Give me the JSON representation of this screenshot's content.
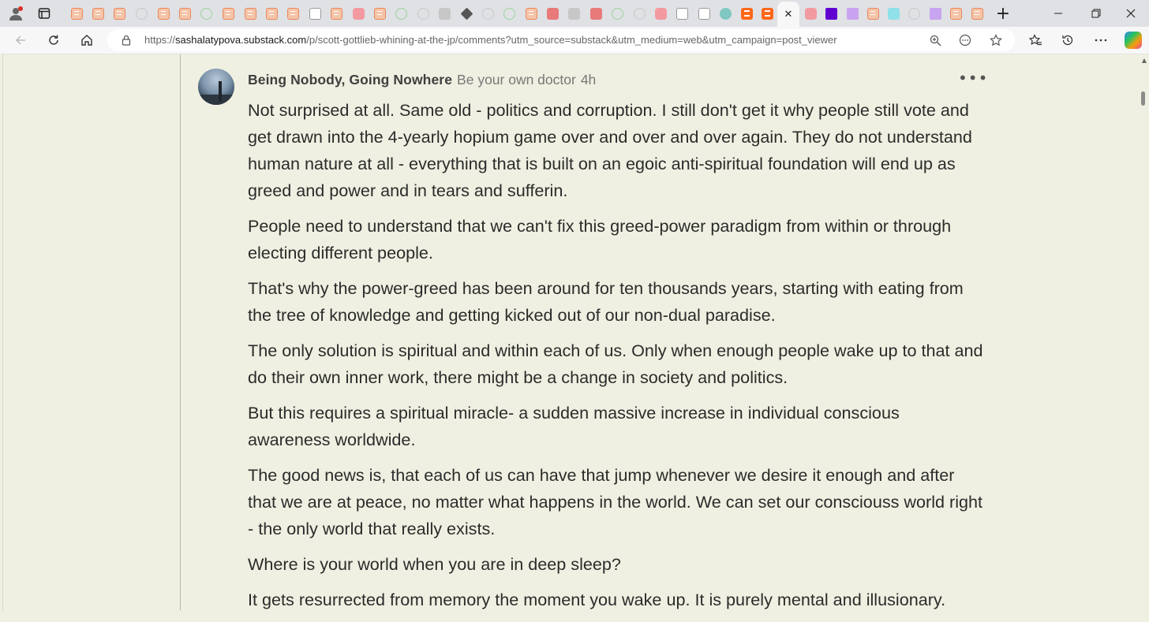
{
  "browser": {
    "url_scheme": "https://",
    "url_host": "sashalatypova.substack.com",
    "url_path": "/p/scott-gottlieb-whining-at-the-jp/comments?utm_source=substack&utm_medium=web&utm_campaign=post_viewer",
    "active_tab_close_symbol": "✕",
    "new_tab_symbol": "+",
    "icons": [
      "profile-icon",
      "tab-actions-icon",
      "back-icon",
      "refresh-icon",
      "home-icon",
      "site-info-icon",
      "zoom-icon",
      "reader-icon",
      "favorite-star-icon",
      "favorites-icon",
      "history-icon",
      "more-icon",
      "copilot-icon",
      "minimize-icon",
      "restore-icon",
      "close-icon"
    ]
  },
  "comment": {
    "author": "Being Nobody, Going Nowhere",
    "author_description": "Be your own doctor",
    "time_ago": "4h",
    "more_symbol": "•••",
    "paragraphs": [
      "Not surprised at all. Same old - politics and corruption. I still don't get it why people still vote and get drawn into the 4-yearly hopium game over and over and over again. They do not understand human nature at all - everything that is built on an egoic anti-spiritual foundation will end up as greed and power and in tears and sufferin.",
      "People need to understand that we can't fix this greed-power paradigm from within or through electing different people.",
      "That's why the power-greed has been around for ten thousands years, starting with eating from the tree of knowledge and getting kicked out of our non-dual paradise.",
      "The only solution is spiritual and within each of us. Only when enough people wake up to that and do their own inner work, there might be a change in society and politics.",
      "But this requires a spiritual miracle- a sudden massive increase in individual conscious awareness worldwide.",
      "The good news is, that each of us can have that jump whenever we desire it enough and after that we are at peace, no matter what happens in the world. We can set our consciouss world right - the only world that really exists.",
      "Where is your world when you are in deep sleep?",
      "It gets resurrected from memory the moment you wake up. It is purely mental and illusionary."
    ]
  }
}
